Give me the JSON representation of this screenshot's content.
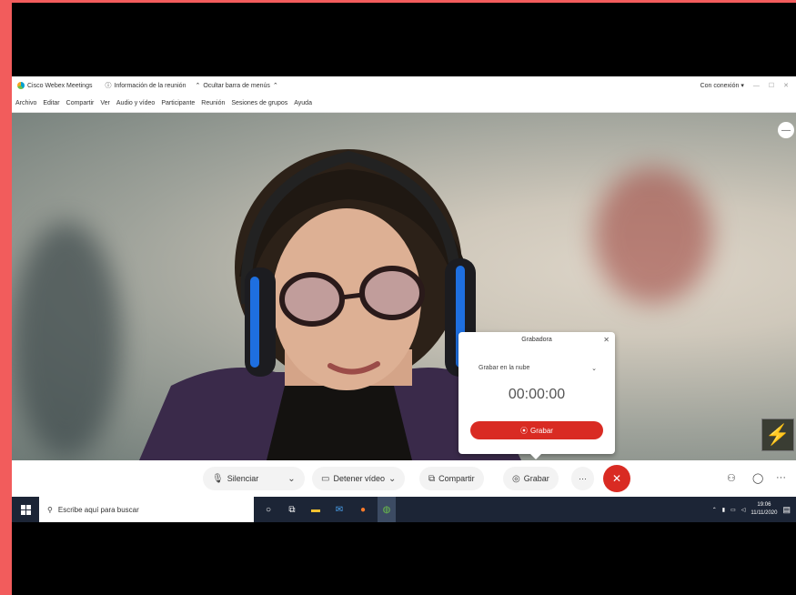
{
  "window": {
    "app_title": "Cisco Webex Meetings",
    "meeting_info": "Información de la reunión",
    "hide_menu": "Ocultar barra de menús",
    "connection": "Con conexión"
  },
  "menu": [
    "Archivo",
    "Editar",
    "Compartir",
    "Ver",
    "Audio y vídeo",
    "Participante",
    "Reunión",
    "Sesiones de grupos",
    "Ayuda"
  ],
  "recorder": {
    "title": "Grabadora",
    "option": "Grabar en la nube",
    "timer": "00:00:00",
    "record_label": "Grabar"
  },
  "controls": {
    "mute": "Silenciar",
    "stop_video": "Detener vídeo",
    "share": "Compartir",
    "record": "Grabar",
    "more": "···"
  },
  "taskbar": {
    "search_placeholder": "Escribe aquí para buscar",
    "time": "19:06",
    "date": "11/11/2020"
  },
  "colors": {
    "accent_red": "#d92b23",
    "frame_red": "#f25c5c",
    "taskbar": "#1c2536"
  }
}
